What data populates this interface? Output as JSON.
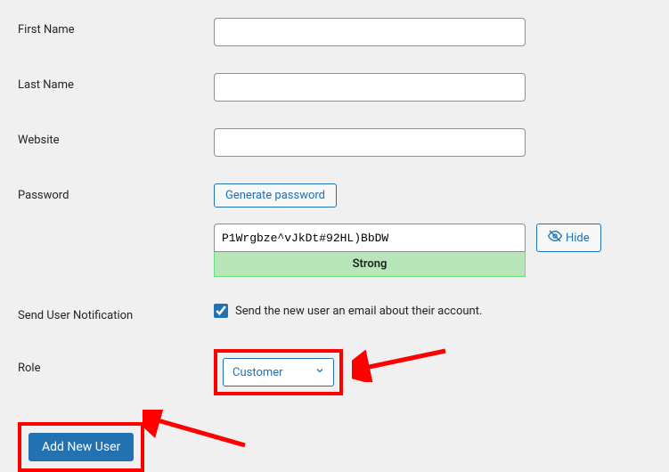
{
  "fields": {
    "first_name": {
      "label": "First Name",
      "value": ""
    },
    "last_name": {
      "label": "Last Name",
      "value": ""
    },
    "website": {
      "label": "Website",
      "value": ""
    },
    "password": {
      "label": "Password",
      "generate_label": "Generate password",
      "value": "P1Wrgbze^vJkDt#92HL)BbDW",
      "hide_label": "Hide",
      "strength": "Strong"
    },
    "notification": {
      "label": "Send User Notification",
      "checkbox_label": "Send the new user an email about their account.",
      "checked": true
    },
    "role": {
      "label": "Role",
      "selected": "Customer"
    }
  },
  "submit_label": "Add New User"
}
